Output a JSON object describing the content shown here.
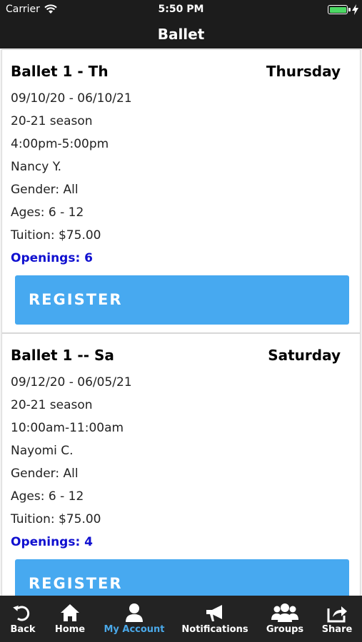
{
  "status": {
    "carrier": "Carrier",
    "time": "5:50 PM"
  },
  "nav": {
    "title": "Ballet"
  },
  "classes": [
    {
      "title": "Ballet 1 - Th",
      "day": "Thursday",
      "dates": "09/10/20 - 06/10/21",
      "season": "20-21 season",
      "time": "4:00pm-5:00pm",
      "instructor": "Nancy Y.",
      "gender": "Gender: All",
      "ages": "Ages: 6 - 12",
      "tuition": "Tuition: $75.00",
      "openings": "Openings: 6",
      "register_label": "REGISTER"
    },
    {
      "title": "Ballet 1 -- Sa",
      "day": "Saturday",
      "dates": "09/12/20 - 06/05/21",
      "season": "20-21 season",
      "time": "10:00am-11:00am",
      "instructor": "Nayomi C.",
      "gender": "Gender: All",
      "ages": "Ages: 6 - 12",
      "tuition": "Tuition: $75.00",
      "openings": "Openings: 4",
      "register_label": "REGISTER"
    }
  ],
  "tabs": [
    {
      "label": "Back",
      "icon": "back-icon"
    },
    {
      "label": "Home",
      "icon": "home-icon"
    },
    {
      "label": "My Account",
      "icon": "account-icon",
      "active": true
    },
    {
      "label": "Notifications",
      "icon": "megaphone-icon"
    },
    {
      "label": "Groups",
      "icon": "groups-icon"
    },
    {
      "label": "Share",
      "icon": "share-icon"
    }
  ],
  "colors": {
    "accent": "#47a9f0",
    "openings": "#1010d0",
    "active_tab": "#4aa8e8",
    "bar": "#1c1c1c"
  }
}
